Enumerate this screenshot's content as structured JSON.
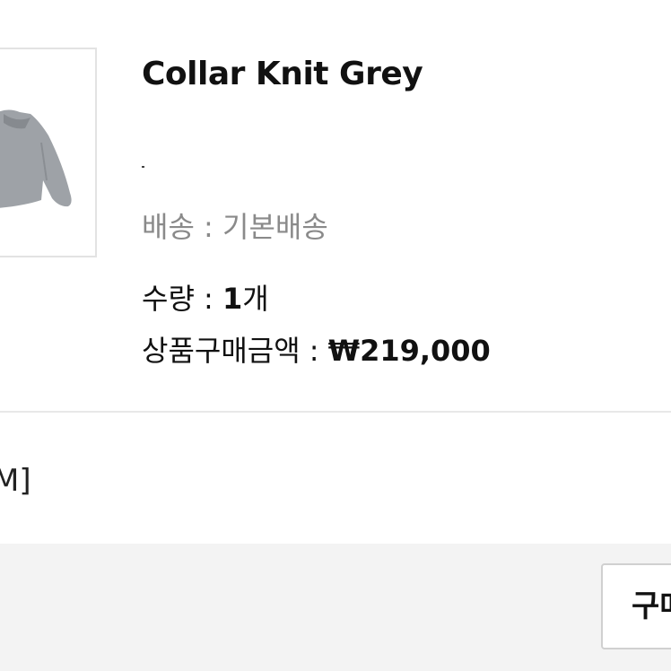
{
  "product": {
    "title": "Collar Knit Grey",
    "image_alt": "grey collar knit sweater",
    "shipping_label": "배송 : ",
    "shipping_value": "기본배송",
    "quantity_label": "수량 : ",
    "quantity_value": "1",
    "quantity_unit": "개",
    "price_label": "상품구매금액 : ",
    "price_value": "₩219,000"
  },
  "option": {
    "text": "M]"
  },
  "footer": {
    "buy_button_label": "구매"
  }
}
